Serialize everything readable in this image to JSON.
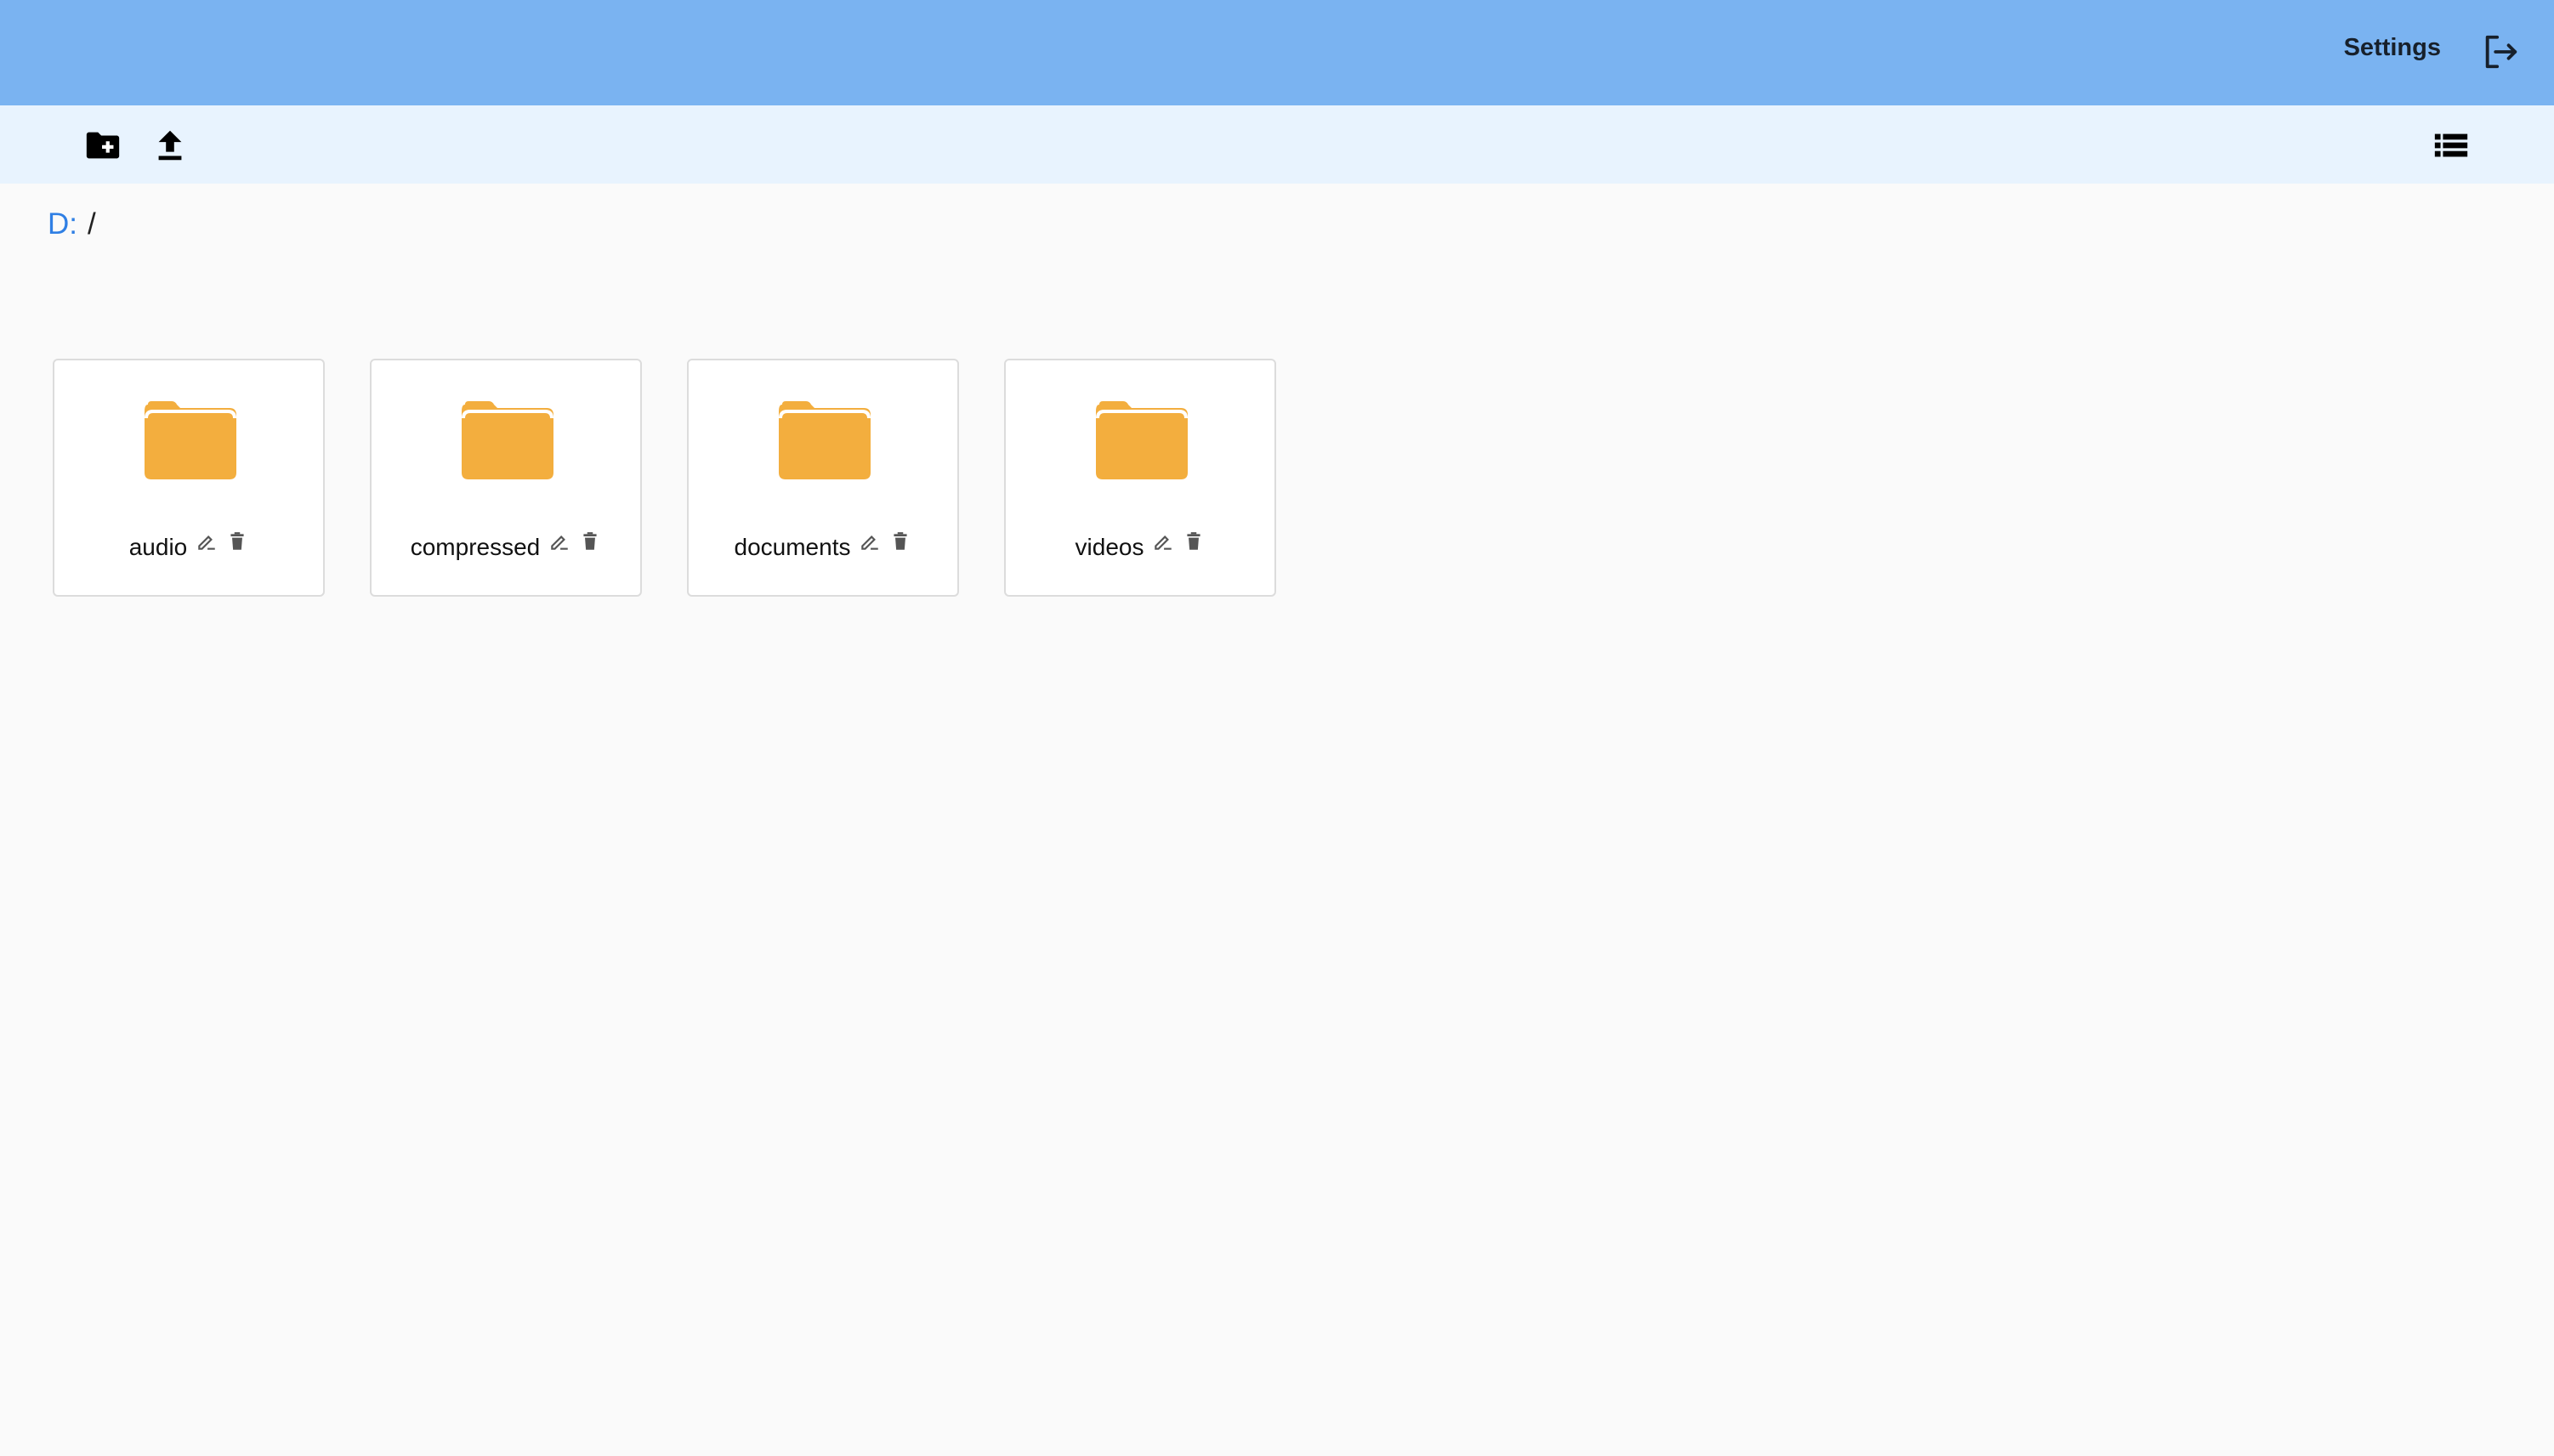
{
  "header": {
    "settings_label": "Settings",
    "logout_icon": "logout-icon"
  },
  "toolbar": {
    "new_folder_icon": "create-new-folder-icon",
    "upload_icon": "upload-icon",
    "view_toggle_icon": "list-view-icon"
  },
  "breadcrumb": {
    "drive": "D:",
    "separator": "/"
  },
  "folders": [
    {
      "name": "audio"
    },
    {
      "name": "compressed"
    },
    {
      "name": "documents"
    },
    {
      "name": "videos"
    }
  ],
  "colors": {
    "header_bg": "#7ab3f1",
    "toolbar_bg": "#e8f3fe",
    "folder": "#f3ae3e",
    "link": "#2f7fe4"
  }
}
